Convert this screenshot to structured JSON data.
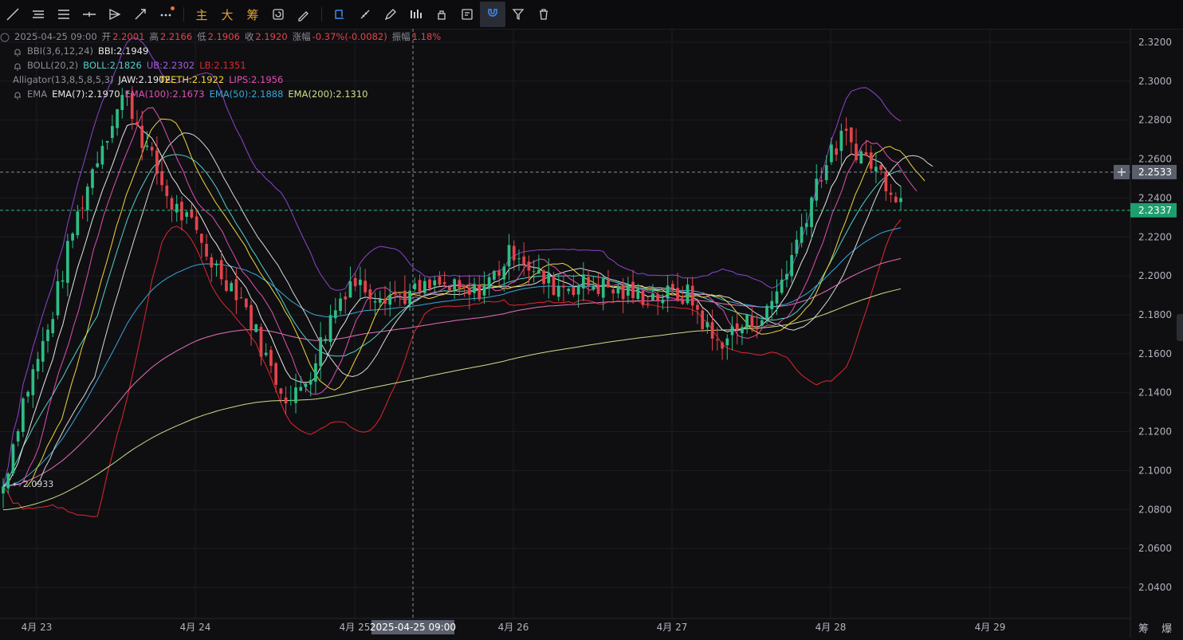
{
  "toolbar": {
    "tools": [
      "trend-line",
      "horizontal-lines",
      "parallel-lines",
      "cross-line",
      "projection",
      "arrow-line",
      "more"
    ],
    "text_buttons": [
      "主",
      "大",
      "筹"
    ],
    "right_tools": [
      "refresh",
      "eraser-pen",
      "select",
      "ruler",
      "brush",
      "bar-compare",
      "lock",
      "notes",
      "magnet",
      "filter",
      "trash"
    ]
  },
  "legend": {
    "ohlc": {
      "datetime": "2025-04-25 09:00",
      "open_label": "开",
      "open": "2.2001",
      "high_label": "高",
      "high": "2.2166",
      "low_label": "低",
      "low": "2.1906",
      "close_label": "收",
      "close": "2.1920",
      "change_label": "涨幅",
      "change": "-0.37%(-0.0082)",
      "amp_label": "振幅",
      "amp": "1.18%"
    },
    "bbi": {
      "name": "BBI(3,6,12,24)",
      "value": "BBI:2.1949"
    },
    "boll": {
      "name": "BOLL(20,2)",
      "mid": "BOLL:2.1826",
      "ub": "UB:2.2302",
      "lb": "LB:2.1351"
    },
    "alligator": {
      "name": "Alligator(13,8,5,8,5,3)",
      "jaw": "JAW:2.1902",
      "teeth": "TEETH:2.1922",
      "lips": "LIPS:2.1956"
    },
    "ema": {
      "name": "EMA",
      "e7": "EMA(7):2.1970",
      "e100": "EMA(100):2.1673",
      "e50": "EMA(50):2.1888",
      "e200": "EMA(200):2.1310"
    }
  },
  "colors": {
    "up": "#2ebd85",
    "down": "#e2444b",
    "boll_ub": "#8e44cc",
    "boll_lb": "#e0262e",
    "white": "#e8e8e8",
    "teeth": "#f2d63c",
    "lips": "#e04fb0",
    "ema50": "#3aa6d8",
    "ema200": "#c8e08a",
    "cyan": "#52d1c6",
    "pink": "#e86eb8"
  },
  "yaxis": {
    "ticks": [
      "2.3200",
      "2.3000",
      "2.2800",
      "2.2600",
      "2.2400",
      "2.2200",
      "2.2000",
      "2.1800",
      "2.1600",
      "2.1400",
      "2.1200",
      "2.1000",
      "2.0800",
      "2.0600",
      "2.0400"
    ],
    "crosshair_price": "2.2533",
    "last_price": "2.2337",
    "min_marker": "← 2.0933"
  },
  "xaxis": {
    "ticks": [
      "4月 23",
      "4月 24",
      "4月 25",
      "4月 26",
      "4月 27",
      "4月 28",
      "4月 29"
    ],
    "crosshair_time": "2025-04-25 09:00"
  },
  "bottom_right": "筹 爆"
}
